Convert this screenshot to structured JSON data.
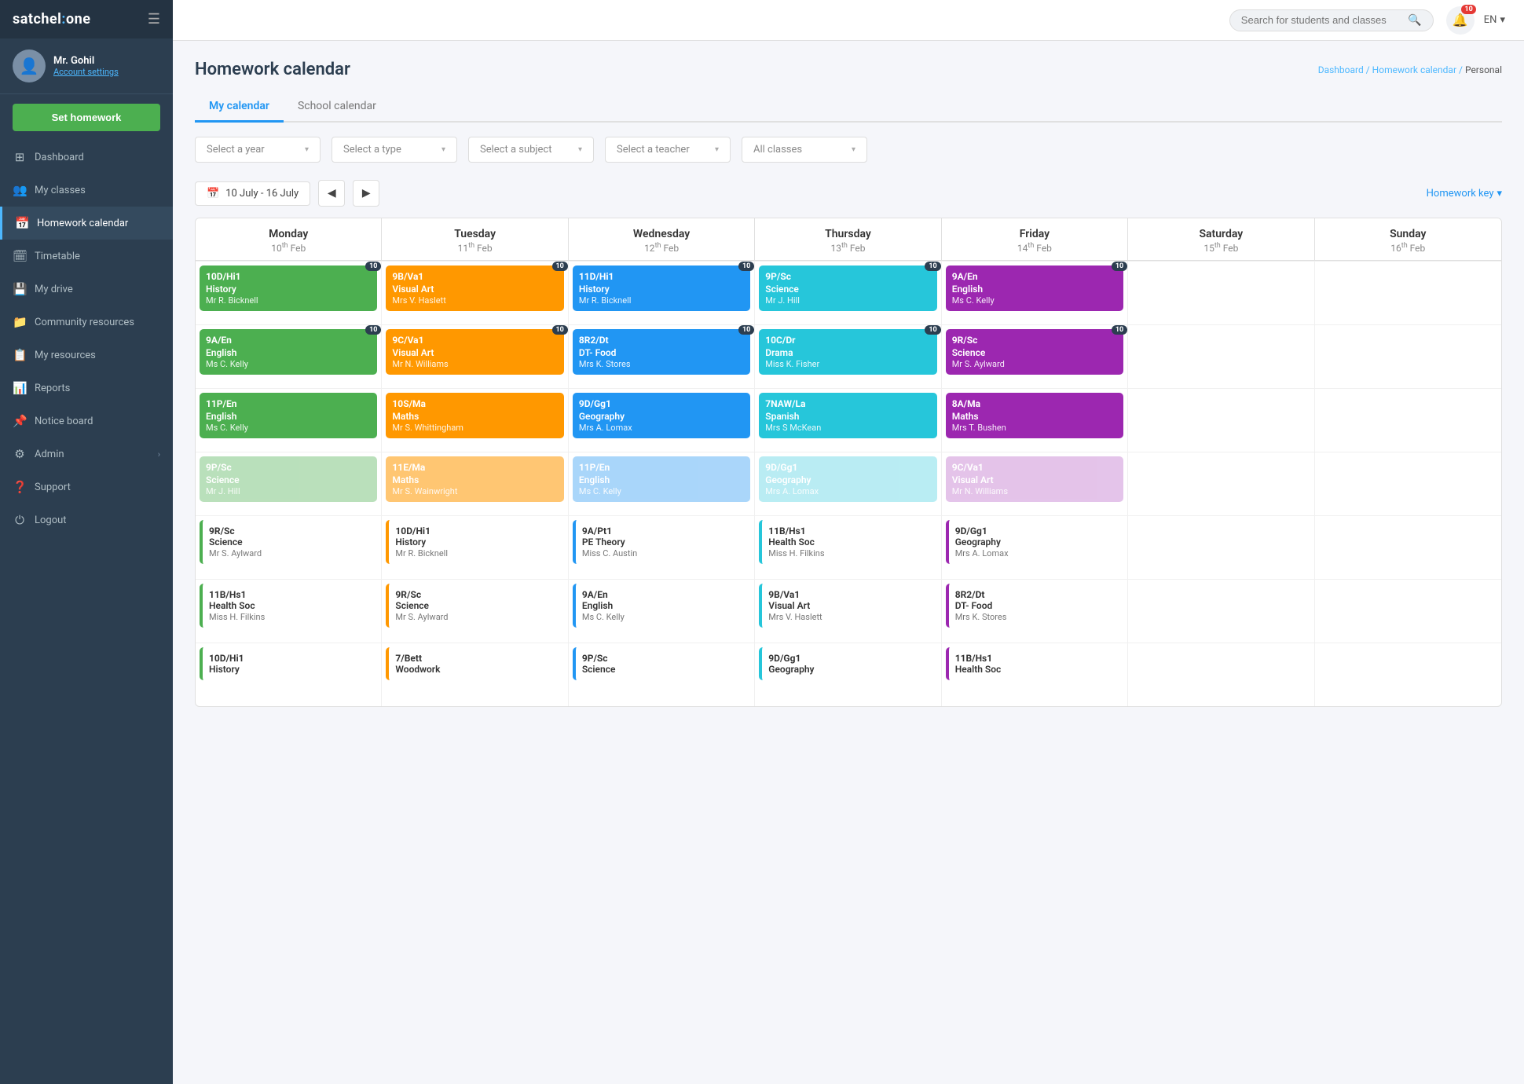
{
  "app": {
    "logo_text": "satchel",
    "logo_colon": ":",
    "logo_one": "one"
  },
  "topbar": {
    "search_placeholder": "Search for students and classes",
    "notif_count": "10",
    "lang": "EN"
  },
  "sidebar": {
    "user_name": "Mr. Gohil",
    "account_settings_label": "Account settings",
    "set_homework_label": "Set homework",
    "nav_items": [
      {
        "id": "dashboard",
        "label": "Dashboard",
        "icon": "⊞",
        "active": false
      },
      {
        "id": "my-classes",
        "label": "My classes",
        "icon": "👥",
        "active": false
      },
      {
        "id": "homework-calendar",
        "label": "Homework calendar",
        "icon": "📅",
        "active": true
      },
      {
        "id": "timetable",
        "label": "Timetable",
        "icon": "🗓",
        "active": false
      },
      {
        "id": "my-drive",
        "label": "My drive",
        "icon": "💾",
        "active": false
      },
      {
        "id": "community-resources",
        "label": "Community resources",
        "icon": "📁",
        "active": false
      },
      {
        "id": "my-resources",
        "label": "My resources",
        "icon": "📋",
        "active": false
      },
      {
        "id": "reports",
        "label": "Reports",
        "icon": "📊",
        "active": false
      },
      {
        "id": "notice-board",
        "label": "Notice board",
        "icon": "📌",
        "active": false
      },
      {
        "id": "admin",
        "label": "Admin",
        "icon": "⚙",
        "active": false,
        "has_arrow": true
      },
      {
        "id": "support",
        "label": "Support",
        "icon": "❓",
        "active": false
      },
      {
        "id": "logout",
        "label": "Logout",
        "icon": "⏻",
        "active": false
      }
    ]
  },
  "page": {
    "title": "Homework calendar",
    "breadcrumb": [
      "Dashboard",
      "Homework calendar",
      "Personal"
    ]
  },
  "tabs": [
    {
      "id": "my-calendar",
      "label": "My calendar",
      "active": true
    },
    {
      "id": "school-calendar",
      "label": "School calendar",
      "active": false
    }
  ],
  "filters": [
    {
      "id": "year",
      "placeholder": "Select a year"
    },
    {
      "id": "type",
      "placeholder": "Select a type"
    },
    {
      "id": "subject",
      "placeholder": "Select a subject"
    },
    {
      "id": "teacher",
      "placeholder": "Select a teacher"
    },
    {
      "id": "classes",
      "placeholder": "All classes"
    }
  ],
  "calendar": {
    "date_range": "10 July - 16 July",
    "homework_key_label": "Homework key",
    "days": [
      {
        "name": "Monday",
        "date": "10",
        "suffix": "th",
        "month": "Feb"
      },
      {
        "name": "Tuesday",
        "date": "11",
        "suffix": "th",
        "month": "Feb"
      },
      {
        "name": "Wednesday",
        "date": "12",
        "suffix": "th",
        "month": "Feb"
      },
      {
        "name": "Thursday",
        "date": "13",
        "suffix": "th",
        "month": "Feb"
      },
      {
        "name": "Friday",
        "date": "14",
        "suffix": "th",
        "month": "Feb"
      },
      {
        "name": "Saturday",
        "date": "15",
        "suffix": "th",
        "month": "Feb"
      },
      {
        "name": "Sunday",
        "date": "16",
        "suffix": "th",
        "month": "Feb"
      }
    ],
    "rows": [
      {
        "cells": [
          {
            "cards": [
              {
                "class": "10D/Hi1",
                "subject": "History",
                "teacher": "Mr R. Bicknell",
                "bg": "bg-green",
                "badge": "10",
                "faded": false
              }
            ]
          },
          {
            "cards": [
              {
                "class": "9B/Va1",
                "subject": "Visual Art",
                "teacher": "Mrs V. Haslett",
                "bg": "bg-orange",
                "badge": "10",
                "faded": false
              }
            ]
          },
          {
            "cards": [
              {
                "class": "11D/Hi1",
                "subject": "History",
                "teacher": "Mr R. Bicknell",
                "bg": "bg-blue",
                "badge": "10",
                "faded": false
              }
            ]
          },
          {
            "cards": [
              {
                "class": "9P/Sc",
                "subject": "Science",
                "teacher": "Mr J. Hill",
                "bg": "bg-teal",
                "badge": "10",
                "faded": false
              }
            ]
          },
          {
            "cards": [
              {
                "class": "9A/En",
                "subject": "English",
                "teacher": "Ms C. Kelly",
                "bg": "bg-purple",
                "badge": "10",
                "faded": false
              }
            ]
          },
          {
            "cards": []
          },
          {
            "cards": []
          }
        ]
      },
      {
        "cells": [
          {
            "cards": [
              {
                "class": "9A/En",
                "subject": "English",
                "teacher": "Ms C. Kelly",
                "bg": "bg-green",
                "badge": "10",
                "faded": false
              }
            ]
          },
          {
            "cards": [
              {
                "class": "9C/Va1",
                "subject": "Visual Art",
                "teacher": "Mr N. Williams",
                "bg": "bg-orange",
                "badge": "10",
                "faded": false
              }
            ]
          },
          {
            "cards": [
              {
                "class": "8R2/Dt",
                "subject": "DT- Food",
                "teacher": "Mrs K. Stores",
                "bg": "bg-blue",
                "badge": "10",
                "faded": false
              }
            ]
          },
          {
            "cards": [
              {
                "class": "10C/Dr",
                "subject": "Drama",
                "teacher": "Miss K. Fisher",
                "bg": "bg-teal",
                "badge": "10",
                "faded": false
              }
            ]
          },
          {
            "cards": [
              {
                "class": "9R/Sc",
                "subject": "Science",
                "teacher": "Mr S. Aylward",
                "bg": "bg-purple",
                "badge": "10",
                "faded": false
              }
            ]
          },
          {
            "cards": []
          },
          {
            "cards": []
          }
        ]
      },
      {
        "cells": [
          {
            "cards": [
              {
                "class": "11P/En",
                "subject": "English",
                "teacher": "Ms C. Kelly",
                "bg": "bg-green",
                "badge": "",
                "faded": false
              }
            ]
          },
          {
            "cards": [
              {
                "class": "10S/Ma",
                "subject": "Maths",
                "teacher": "Mr S. Whittingham",
                "bg": "bg-orange",
                "badge": "",
                "faded": false
              }
            ]
          },
          {
            "cards": [
              {
                "class": "9D/Gg1",
                "subject": "Geography",
                "teacher": "Mrs A. Lomax",
                "bg": "bg-blue",
                "badge": "",
                "faded": false
              }
            ]
          },
          {
            "cards": [
              {
                "class": "7NAW/La",
                "subject": "Spanish",
                "teacher": "Mrs S McKean",
                "bg": "bg-teal",
                "badge": "",
                "faded": false
              }
            ]
          },
          {
            "cards": [
              {
                "class": "8A/Ma",
                "subject": "Maths",
                "teacher": "Mrs T. Bushen",
                "bg": "bg-purple",
                "badge": "",
                "faded": false
              }
            ]
          },
          {
            "cards": []
          },
          {
            "cards": []
          }
        ]
      },
      {
        "cells": [
          {
            "cards": [
              {
                "class": "9P/Sc",
                "subject": "Science",
                "teacher": "Mr J. Hill",
                "bg": "bg-green-light",
                "badge": "",
                "faded": true
              }
            ]
          },
          {
            "cards": [
              {
                "class": "11E/Ma",
                "subject": "Maths",
                "teacher": "Mr S. Wainwright",
                "bg": "bg-orange",
                "badge": "",
                "faded": true
              }
            ]
          },
          {
            "cards": [
              {
                "class": "11P/En",
                "subject": "English",
                "teacher": "Ms C. Kelly",
                "bg": "bg-blue-light",
                "badge": "",
                "faded": true
              }
            ]
          },
          {
            "cards": [
              {
                "class": "9D/Gg1",
                "subject": "Geography",
                "teacher": "Mrs A. Lomax",
                "bg": "bg-teal-light",
                "badge": "",
                "faded": true
              }
            ]
          },
          {
            "cards": [
              {
                "class": "9C/Va1",
                "subject": "Visual Art",
                "teacher": "Mr N. Williams",
                "bg": "bg-purple-light",
                "badge": "",
                "faded": true
              }
            ]
          },
          {
            "cards": []
          },
          {
            "cards": []
          }
        ]
      },
      {
        "cells": [
          {
            "cards": [
              {
                "class": "9R/Sc",
                "subject": "Science",
                "teacher": "Mr S. Aylward",
                "bg": "",
                "badge": "",
                "faded": false,
                "outline": true,
                "border": "border-green"
              }
            ]
          },
          {
            "cards": [
              {
                "class": "10D/Hi1",
                "subject": "History",
                "teacher": "Mr R. Bicknell",
                "bg": "",
                "badge": "",
                "faded": false,
                "outline": true,
                "border": "border-orange"
              }
            ]
          },
          {
            "cards": [
              {
                "class": "9A/Pt1",
                "subject": "PE Theory",
                "teacher": "Miss C. Austin",
                "bg": "",
                "badge": "",
                "faded": false,
                "outline": true,
                "border": "border-blue"
              }
            ]
          },
          {
            "cards": [
              {
                "class": "11B/Hs1",
                "subject": "Health Soc",
                "teacher": "Miss H. Filkins",
                "bg": "",
                "badge": "",
                "faded": false,
                "outline": true,
                "border": "border-teal"
              }
            ]
          },
          {
            "cards": [
              {
                "class": "9D/Gg1",
                "subject": "Geography",
                "teacher": "Mrs A. Lomax",
                "bg": "",
                "badge": "",
                "faded": false,
                "outline": true,
                "border": "border-purple"
              }
            ]
          },
          {
            "cards": []
          },
          {
            "cards": []
          }
        ]
      },
      {
        "cells": [
          {
            "cards": [
              {
                "class": "11B/Hs1",
                "subject": "Health Soc",
                "teacher": "Miss H. Filkins",
                "bg": "",
                "badge": "",
                "faded": false,
                "outline": true,
                "border": "border-green"
              }
            ]
          },
          {
            "cards": [
              {
                "class": "9R/Sc",
                "subject": "Science",
                "teacher": "Mr S. Aylward",
                "bg": "",
                "badge": "",
                "faded": false,
                "outline": true,
                "border": "border-orange"
              }
            ]
          },
          {
            "cards": [
              {
                "class": "9A/En",
                "subject": "English",
                "teacher": "Ms C. Kelly",
                "bg": "",
                "badge": "",
                "faded": false,
                "outline": true,
                "border": "border-blue"
              }
            ]
          },
          {
            "cards": [
              {
                "class": "9B/Va1",
                "subject": "Visual Art",
                "teacher": "Mrs V. Haslett",
                "bg": "",
                "badge": "",
                "faded": false,
                "outline": true,
                "border": "border-teal"
              }
            ]
          },
          {
            "cards": [
              {
                "class": "8R2/Dt",
                "subject": "DT- Food",
                "teacher": "Mrs K. Stores",
                "bg": "",
                "badge": "",
                "faded": false,
                "outline": true,
                "border": "border-purple"
              }
            ]
          },
          {
            "cards": []
          },
          {
            "cards": []
          }
        ]
      },
      {
        "cells": [
          {
            "cards": [
              {
                "class": "10D/Hi1",
                "subject": "History",
                "teacher": "",
                "bg": "",
                "badge": "",
                "faded": false,
                "outline": true,
                "border": "border-green"
              }
            ]
          },
          {
            "cards": [
              {
                "class": "7/Bett",
                "subject": "Woodwork",
                "teacher": "",
                "bg": "",
                "badge": "",
                "faded": false,
                "outline": true,
                "border": "border-orange"
              }
            ]
          },
          {
            "cards": [
              {
                "class": "9P/Sc",
                "subject": "Science",
                "teacher": "",
                "bg": "",
                "badge": "",
                "faded": false,
                "outline": true,
                "border": "border-blue"
              }
            ]
          },
          {
            "cards": [
              {
                "class": "9D/Gg1",
                "subject": "Geography",
                "teacher": "",
                "bg": "",
                "badge": "",
                "faded": false,
                "outline": true,
                "border": "border-teal"
              }
            ]
          },
          {
            "cards": [
              {
                "class": "11B/Hs1",
                "subject": "Health Soc",
                "teacher": "",
                "bg": "",
                "badge": "",
                "faded": false,
                "outline": true,
                "border": "border-purple"
              }
            ]
          },
          {
            "cards": []
          },
          {
            "cards": []
          }
        ]
      }
    ]
  }
}
